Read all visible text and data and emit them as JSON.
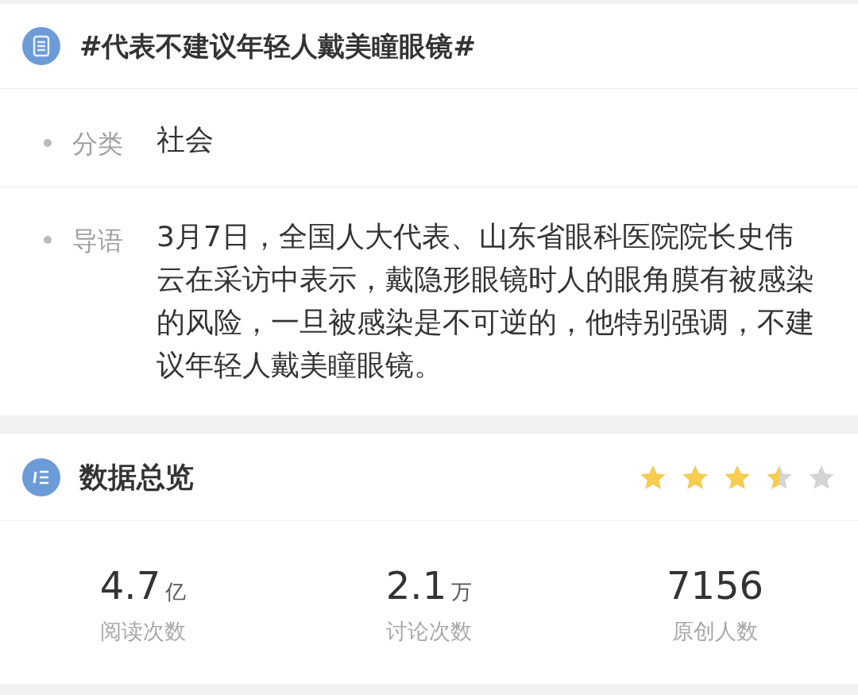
{
  "topic": {
    "title": "#代表不建议年轻人戴美瞳眼镜#"
  },
  "details": [
    {
      "label": "分类",
      "value": "社会"
    },
    {
      "label": "导语",
      "value": "3月7日，全国人大代表、山东省眼科医院院长史伟云在采访中表示，戴隐形眼镜时人的眼角膜有被感染的风险，一旦被感染是不可逆的，他特别强调，不建议年轻人戴美瞳眼镜。"
    }
  ],
  "overview": {
    "title": "数据总览",
    "stars": 3.5,
    "stats": [
      {
        "number": "4.7",
        "unit": "亿",
        "label": "阅读次数"
      },
      {
        "number": "2.1",
        "unit": "万",
        "label": "讨论次数"
      },
      {
        "number": "7156",
        "label": "原创人数"
      }
    ]
  }
}
